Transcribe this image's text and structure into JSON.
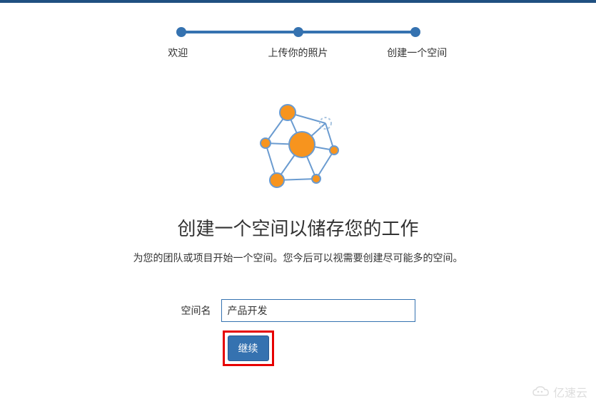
{
  "progress": {
    "steps": [
      {
        "label": "欢迎"
      },
      {
        "label": "上传你的照片"
      },
      {
        "label": "创建一个空间"
      }
    ]
  },
  "main": {
    "heading": "创建一个空间以储存您的工作",
    "subheading": "为您的团队或项目开始一个空间。您今后可以视需要创建尽可能多的空间。"
  },
  "form": {
    "space_name_label": "空间名",
    "space_name_value": "产品开发",
    "submit_label": "继续"
  },
  "watermark": {
    "text": "亿速云"
  },
  "colors": {
    "primary": "#3572b0",
    "top_bar": "#205081",
    "highlight_border": "#e60000"
  }
}
